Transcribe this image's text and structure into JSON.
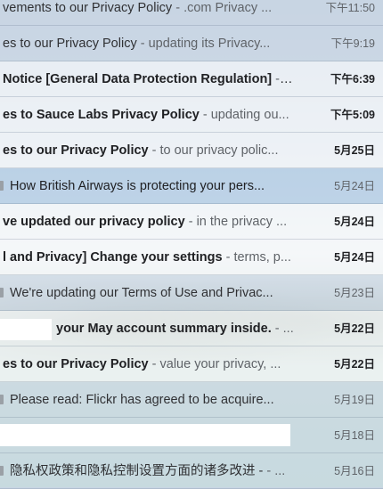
{
  "emails": [
    {
      "subject": "vements to our Privacy Policy",
      "snippet": ".com Privacy ...",
      "date": "下午11:50",
      "state": "read",
      "tag": false,
      "bold": false
    },
    {
      "subject": "es to our Privacy Policy",
      "snippet": "updating its Privacy...",
      "date": "下午9:19",
      "state": "read",
      "tag": false,
      "bold": false
    },
    {
      "subject": " Notice [General Data Protection Regulation]",
      "snippet": "...",
      "date": "下午6:39",
      "state": "unread",
      "tag": false,
      "bold": true
    },
    {
      "subject": "es to Sauce Labs Privacy Policy",
      "snippet": "updating ou...",
      "date": "下午5:09",
      "state": "unread",
      "tag": false,
      "bold": true
    },
    {
      "subject": "es to our Privacy Policy",
      "snippet": "to our privacy polic...",
      "date": "5月25日",
      "state": "unread",
      "tag": false,
      "bold": true
    },
    {
      "subject": "How British Airways is protecting your pers...",
      "snippet": "",
      "date": "5月24日",
      "state": "selected",
      "tag": true,
      "bold": false
    },
    {
      "subject": "ve updated our privacy policy",
      "snippet": "in the privacy ...",
      "date": "5月24日",
      "state": "unread",
      "tag": false,
      "bold": true
    },
    {
      "subject": "l and Privacy] Change your settings",
      "snippet": "terms, p...",
      "date": "5月24日",
      "state": "unread",
      "tag": false,
      "bold": true
    },
    {
      "subject": "We're updating our Terms of Use and Privac...",
      "snippet": "",
      "date": "5月23日",
      "state": "read",
      "tag": true,
      "bold": false
    },
    {
      "subject": "your May account summary inside.",
      "snippet": "...",
      "date": "5月22日",
      "state": "unread",
      "tag": false,
      "bold": true,
      "mask": true
    },
    {
      "subject": "es to our Privacy Policy",
      "snippet": "value your privacy, ...",
      "date": "5月22日",
      "state": "unread",
      "tag": false,
      "bold": true
    },
    {
      "subject": "Please read: Flickr has agreed to be acquire...",
      "snippet": "",
      "date": "5月19日",
      "state": "read",
      "tag": true,
      "bold": false
    },
    {
      "subject": "",
      "snippet": "",
      "date": "5月18日",
      "state": "read",
      "tag": false,
      "bold": false,
      "blank": true
    },
    {
      "subject": "隐私权政策和隐私控制设置方面的诸多改进 -",
      "snippet": "...",
      "date": "5月16日",
      "state": "read",
      "tag": true,
      "bold": false
    }
  ]
}
